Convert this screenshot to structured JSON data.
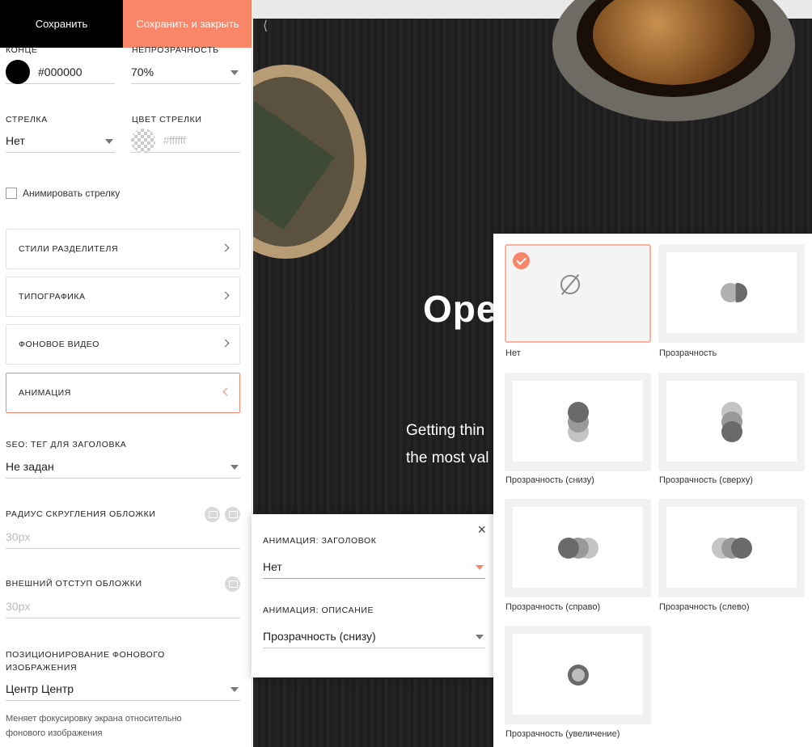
{
  "toolbar": {
    "save": "Сохранить",
    "save_close": "Сохранить и закрыть"
  },
  "fields": {
    "end_label": "Конце",
    "end_color": "#000000",
    "opacity_label": "Непрозрачность",
    "opacity_value": "70%",
    "arrow_label": "Стрелка",
    "arrow_value": "Нет",
    "arrow_color_label": "Цвет стрелки",
    "arrow_color_placeholder": "#ffffff",
    "animate_arrow": "Анимировать стрелку",
    "seo_label": "SEO: тег для заголовка",
    "seo_value": "Не задан",
    "radius_label": "Радиус скругления обложки",
    "radius_placeholder": "30px",
    "margin_label": "Внешний отступ обложки",
    "margin_placeholder": "30px",
    "position_label": "Позиционирование фонового изображения",
    "position_value": "Центр Центр",
    "position_note": "Меняет фокусировку экрана относительно фонового изображения"
  },
  "sections": [
    {
      "label": "Стили разделителя"
    },
    {
      "label": "Типографика"
    },
    {
      "label": "Фоновое видео"
    },
    {
      "label": "Анимация",
      "active": true
    }
  ],
  "preview": {
    "title": "Ope",
    "text_line1": "Getting thin",
    "text_line2": "the most val"
  },
  "popover": {
    "title_label": "Анимация: заголовок",
    "title_value": "Нет",
    "desc_label": "Анимация: описание",
    "desc_value": "Прозрачность (снизу)"
  },
  "options": [
    {
      "label": "Нет",
      "selected": true
    },
    {
      "label": "Прозрачность"
    },
    {
      "label": "Прозрачность (снизу)"
    },
    {
      "label": "Прозрачность (сверху)"
    },
    {
      "label": "Прозрачность (справо)"
    },
    {
      "label": "Прозрачность (слево)"
    },
    {
      "label": "Прозрачность (увеличение)"
    }
  ],
  "colors": {
    "accent": "#fa8669",
    "dark": "#000000"
  }
}
